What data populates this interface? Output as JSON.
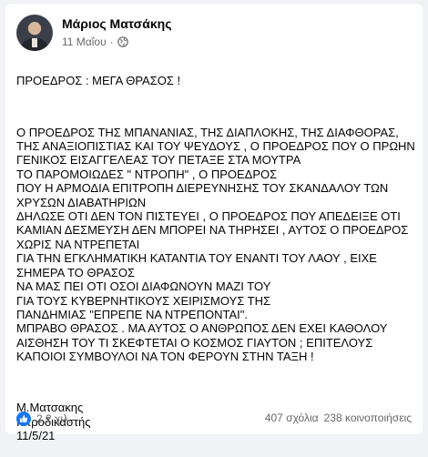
{
  "post": {
    "author": "Μάριος Ματσάκης",
    "date": "11 Μαΐου",
    "dot": "·",
    "body": [
      "ΠΡΟΕΔΡΟΣ : ΜΕΓΑ ΘΡΑΣΟΣ !",
      "Ο ΠΡΟΕΔΡΟΣ ΤΗΣ ΜΠΑΝΑΝΙΑΣ, ΤΗΣ ΔΙΑΠΛΟΚΗΣ, ΤΗΣ ΔΙΑΦΘΟΡΑΣ,\nΤΗΣ ΑΝΑΞΙΟΠΙΣΤΙΑΣ ΚΑΙ ΤΟΥ ΨΕΥΔΟΥΣ , Ο ΠΡΟΕΔΡΟΣ ΠΟΥ Ο ΠΡΩΗΝ\nΓΕΝΙΚΟΣ ΕΙΣΑΓΓΕΛΕΑΣ ΤΟΥ ΠΕΤΑΞΕ ΣΤΑ ΜΟΥΤΡΑ\nΤΟ ΠΑΡΟΜΟΙΩΔΕΣ \" ΝΤΡΟΠΗ\" , Ο ΠΡΟΕΔΡΟΣ\nΠΟΥ Η ΑΡΜΟΔΙΑ ΕΠΙΤΡΟΠΗ ΔΙΕΡΕΥΝΗΣΗΣ ΤΟΥ ΣΚΑΝΔΑΛΟΥ ΤΩΝ\nΧΡΥΣΩΝ ΔΙΑΒΑΤΗΡΙΩΝ\nΔΗΛΩΣΕ ΟΤΙ ΔΕΝ ΤΟΝ ΠΙΣΤΕΥΕΙ , Ο ΠΡΟΕΔΡΟΣ ΠΟΥ ΑΠΕΔΕΙΞΕ ΟΤΙ\nΚΑΜΙΑΝ ΔΕΣΜΕΥΣΗ ΔΕΝ ΜΠΟΡΕΙ ΝΑ ΤΗΡΗΣΕΙ , ΑΥΤΟΣ Ο ΠΡΟΕΔΡΟΣ\nΧΩΡΙΣ ΝΑ ΝΤΡΕΠΕΤΑΙ\nΓΙΑ ΤΗΝ ΕΓΚΛΗΜΑΤΙΚΗ ΚΑΤΑΝΤΙΑ ΤΟΥ ΕΝΑΝΤΙ ΤΟΥ ΛΑΟΥ , ΕΙΧΕ\nΣΗΜΕΡΑ ΤΟ ΘΡΑΣΟΣ\nΝΑ ΜΑΣ ΠΕΙ ΟΤΙ ΟΣΟΙ ΔΙΑΦΩΝΟΥΝ ΜΑΖΙ ΤΟΥ\nΓΙΑ ΤΟΥΣ ΚΥΒΕΡΝΗΤΙΚΟΥΣ ΧΕΙΡΙΣΜΟΥΣ ΤΗΣ\nΠΑΝΔΗΜΙΑΣ \"ΕΠΡΕΠΕ ΝΑ ΝΤΡΕΠΟΝΤΑΙ\".\nΜΠΡΑΒΟ ΘΡΑΣΟΣ . ΜΑ ΑΥΤΟΣ Ο ΑΝΘΡΩΠΟΣ ΔΕΝ ΕΧΕΙ ΚΑΘΟΛΟΥ\nΑΙΣΘΗΣΗ ΤΟΥ ΤΙ ΣΚΕΦΤΕΤΑΙ Ο ΚΟΣΜΟΣ ΓΙΑΥΤΟΝ ; ΕΠΙΤΕΛΟΥΣ\nΚΑΠΟΙΟΙ ΣΥΜΒΟΥΛΟΙ ΝΑ ΤΟΝ ΦΕΡΟΥΝ ΣΤΗΝ ΤΑΞΗ !",
      "Μ.Ματσακης\nΙατροδικαστής\n11/5/21"
    ]
  },
  "footer": {
    "reactions": "2,2 χιλ.",
    "comments": "407 σχόλια",
    "shares": "238 κοινοποιήσεις"
  },
  "icons": {
    "avatar": "profile-photo",
    "globe": "globe-icon",
    "like": "like-icon"
  },
  "colors": {
    "like_blue": "#1877f2",
    "meta_gray": "#65676b"
  }
}
